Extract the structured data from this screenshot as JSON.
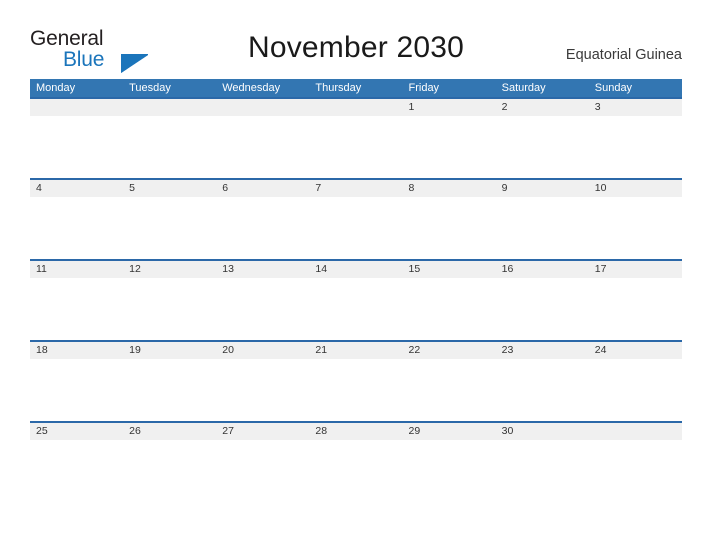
{
  "brand": {
    "name_part1": "General",
    "name_part2": "Blue",
    "flag_icon": "flag-triangle-icon",
    "primary_color": "#1b75bb",
    "text_color": "#231f20"
  },
  "header": {
    "title": "November 2030",
    "country": "Equatorial Guinea"
  },
  "calendar": {
    "header_background": "#3376b2",
    "band_background": "#f0f0f0",
    "band_border_color": "#2b68a8",
    "weekdays": [
      "Monday",
      "Tuesday",
      "Wednesday",
      "Thursday",
      "Friday",
      "Saturday",
      "Sunday"
    ],
    "weeks": [
      [
        "",
        "",
        "",
        "",
        "1",
        "2",
        "3"
      ],
      [
        "4",
        "5",
        "6",
        "7",
        "8",
        "9",
        "10"
      ],
      [
        "11",
        "12",
        "13",
        "14",
        "15",
        "16",
        "17"
      ],
      [
        "18",
        "19",
        "20",
        "21",
        "22",
        "23",
        "24"
      ],
      [
        "25",
        "26",
        "27",
        "28",
        "29",
        "30",
        ""
      ]
    ]
  }
}
